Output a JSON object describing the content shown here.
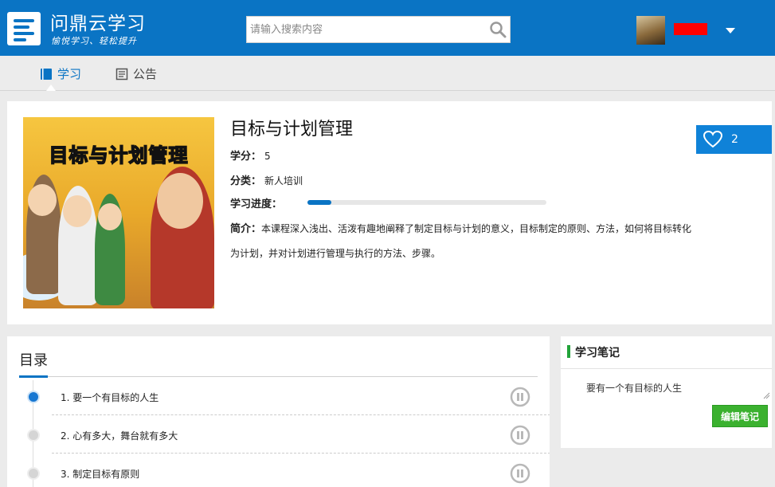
{
  "header": {
    "brand": "问鼎云学习",
    "slogan": "愉悦学习、轻松提升",
    "search_placeholder": "请输入搜索内容"
  },
  "nav": {
    "tabs": [
      {
        "label": "学习",
        "active": true
      },
      {
        "label": "公告",
        "active": false
      }
    ]
  },
  "course": {
    "title": "目标与计划管理",
    "cover_title": "目标与计划管理",
    "credit_label": "学分：",
    "credit_value": "5",
    "category_label": "分类：",
    "category_value": "新人培训",
    "progress_label": "学习进度：",
    "progress_value": 0.1,
    "intro_label": "简介：",
    "intro_text": "本课程深入浅出、活泼有趣地阐释了制定目标与计划的意义，目标制定的原则、方法，如何将目标转化为计划，并对计划进行管理与执行的方法、步骤。",
    "likes": "2",
    "accent_color": "#0a74c4"
  },
  "catalog": {
    "title": "目录",
    "items": [
      {
        "label": "1. 要一个有目标的人生",
        "active": true
      },
      {
        "label": "2. 心有多大，舞台就有多大",
        "active": false
      },
      {
        "label": "3. 制定目标有原则",
        "active": false
      }
    ]
  },
  "notes": {
    "title": "学习笔记",
    "content": "要有一个有目标的人生",
    "edit_label": "编辑笔记"
  }
}
